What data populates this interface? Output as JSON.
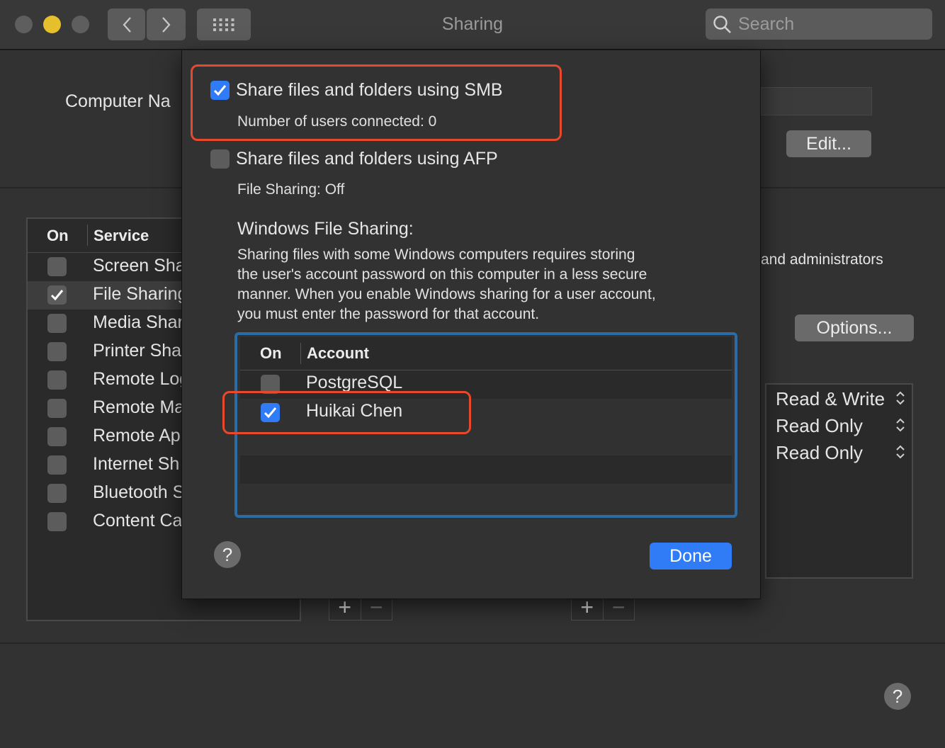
{
  "window": {
    "title": "Sharing",
    "search_placeholder": "Search"
  },
  "main": {
    "computer_name_label": "Computer Na",
    "edit_button": "Edit...",
    "admin_text": "and administrators",
    "options_button": "Options...",
    "services_header": {
      "on": "On",
      "service": "Service"
    },
    "services": [
      {
        "label": "Screen Sha",
        "checked": false
      },
      {
        "label": "File Sharing",
        "checked": true
      },
      {
        "label": "Media Shar",
        "checked": false
      },
      {
        "label": "Printer Sha",
        "checked": false
      },
      {
        "label": "Remote Log",
        "checked": false
      },
      {
        "label": "Remote Ma",
        "checked": false
      },
      {
        "label": "Remote Ap",
        "checked": false
      },
      {
        "label": "Internet Sh",
        "checked": false
      },
      {
        "label": "Bluetooth S",
        "checked": false
      },
      {
        "label": "Content Ca",
        "checked": false
      }
    ],
    "permissions": [
      "Read & Write",
      "Read Only",
      "Read Only"
    ],
    "plus": "+",
    "minus": "−",
    "help": "?"
  },
  "sheet": {
    "smb_label": "Share files and folders using SMB",
    "smb_checked": true,
    "smb_users": "Number of users connected: 0",
    "afp_label": "Share files and folders using AFP",
    "afp_checked": false,
    "afp_status": "File Sharing: Off",
    "windows_heading": "Windows File Sharing:",
    "windows_desc": [
      "Sharing files with some Windows computers requires storing",
      "the user's account password on this computer in a less secure",
      "manner. When you enable Windows sharing for a user account,",
      "you must enter the password for that account."
    ],
    "accounts_header": {
      "on": "On",
      "account": "Account"
    },
    "accounts": [
      {
        "name": "PostgreSQL",
        "checked": false
      },
      {
        "name": "Huikai Chen",
        "checked": true
      }
    ],
    "help": "?",
    "done_button": "Done"
  },
  "colors": {
    "accent_blue": "#2f7cf6",
    "highlight_red": "#e8492c",
    "highlight_blue": "#2b6ca6"
  }
}
